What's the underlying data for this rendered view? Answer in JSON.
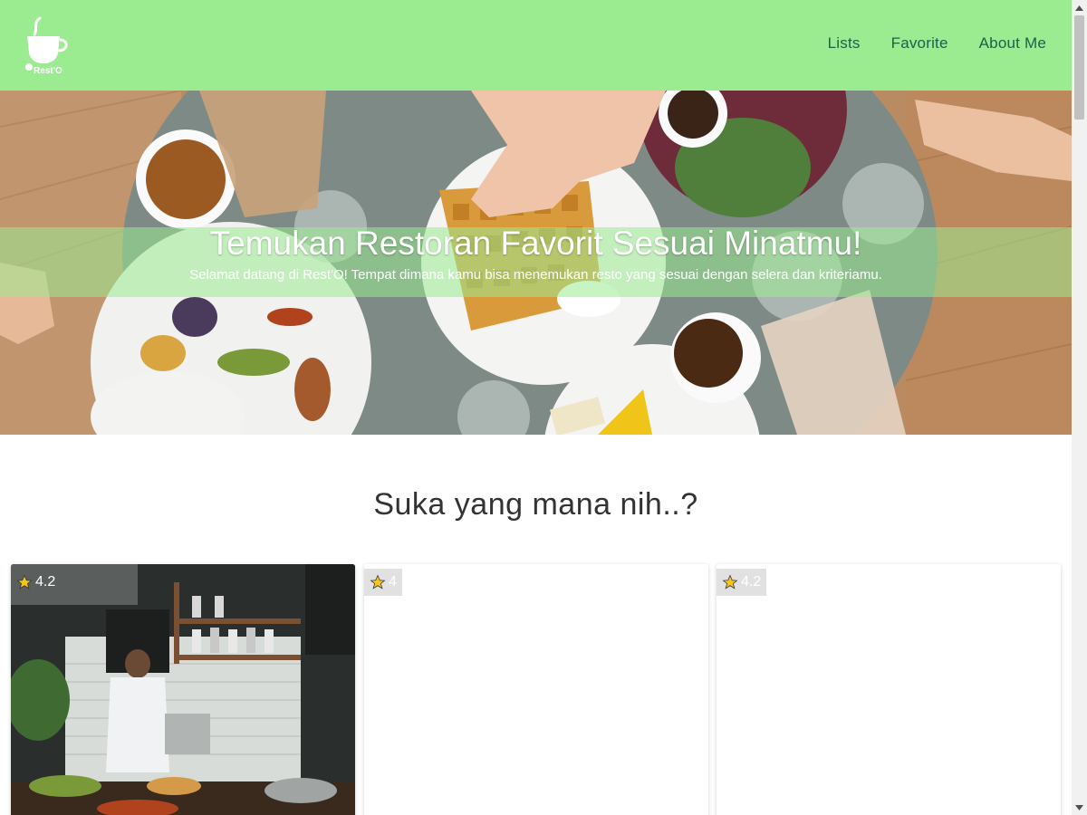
{
  "header": {
    "logo_text": "Rest'O",
    "nav": [
      {
        "label": "Lists"
      },
      {
        "label": "Favorite"
      },
      {
        "label": "About Me"
      }
    ]
  },
  "hero": {
    "title": "Temukan Restoran Favorit Sesuai Minatmu!",
    "subtitle": "Selamat datang di Rest'O! Tempat dimana kamu bisa menemukan resto yang sesuai dengan selera dan kriteriamu."
  },
  "section": {
    "title": "Suka yang mana nih..?"
  },
  "restaurants": [
    {
      "rating": "4.2",
      "icon": "star-icon"
    },
    {
      "rating": "4",
      "icon": "star-icon"
    },
    {
      "rating": "4.2",
      "icon": "star-icon"
    }
  ],
  "colors": {
    "navbar": "#9beb91",
    "nav_text": "#1f5f4a",
    "star": "#f5c518"
  }
}
